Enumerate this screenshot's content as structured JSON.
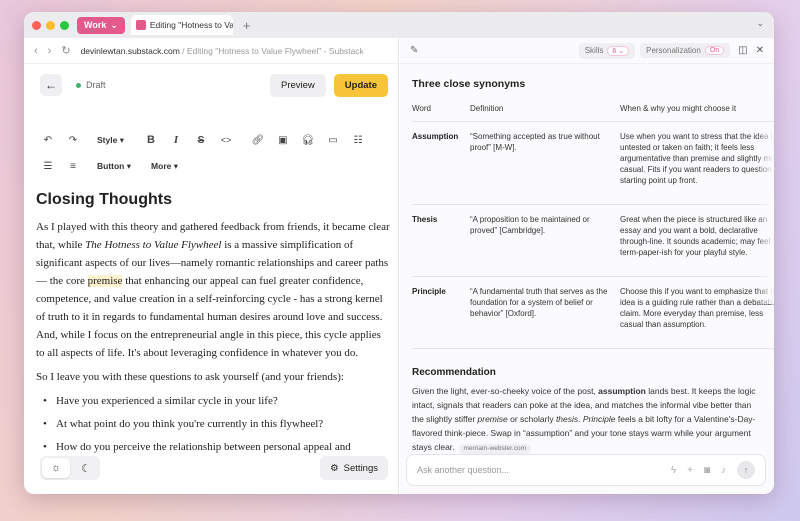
{
  "tabbar": {
    "workspace": "Work",
    "tab_title": "Editing \"Hotness to Va",
    "new_tab": "+",
    "menu_chevron": "⌄"
  },
  "urlbar": {
    "domain": "devinlewtan.substack.com",
    "rest": " / Editing \"Hotness to Value Flywheel\" - Substack"
  },
  "editor": {
    "status": "Draft",
    "preview_label": "Preview",
    "update_label": "Update",
    "style_label": "Style",
    "button_label": "Button",
    "more_label": "More",
    "settings_label": "Settings"
  },
  "article": {
    "heading": "Closing Thoughts",
    "p1_a": "As I played with this theory and gathered feedback from friends, it became clear that, while ",
    "p1_em": "The Hotness to Value Flywheel",
    "p1_b": " is a massive simplification of significant aspects of our lives—namely romantic relationships and career paths— the core ",
    "p1_hl": "premise",
    "p1_c": " that enhancing our appeal can fuel greater confidence, competence, and value creation in a self-reinforcing cycle - has a strong kernel of truth to it in regards to fundamental human desires around love and success. And, while I focus on the entrepreneurial angle in this piece, this cycle applies to all aspects of life. It's about leveraging confidence in whatever you do.",
    "p2": "So I leave you with these questions to ask yourself (and your friends):",
    "bullets": [
      "Have you experienced a similar cycle in your life?",
      "At what point do you think you're currently in this flywheel?",
      "How do you perceive the relationship between personal appeal and"
    ]
  },
  "assistant": {
    "skills_label": "Skills",
    "skills_count": "6",
    "personalization_label": "Personalization",
    "personalization_state": "On",
    "title": "Three close synonyms",
    "columns": [
      "Word",
      "Definition",
      "When & why you might choose it"
    ],
    "rows": [
      {
        "word": "Assumption",
        "definition": "“Something accepted as true without proof” [M-W].",
        "when": "Use when you want to stress that the idea is untested or taken on faith; it feels less argumentative than premise and slightly more casual. Fits if you want readers to question the starting point up front."
      },
      {
        "word": "Thesis",
        "definition": "“A proposition to be maintained or proved” [Cambridge].",
        "when": "Great when the piece is structured like an essay and you want a bold, declarative through-line. It sounds academic; may feel too term-paper-ish for your playful style."
      },
      {
        "word": "Principle",
        "definition": "“A fundamental truth that serves as the foundation for a system of belief or behavior” [Oxford].",
        "when": "Choose this if you want to emphasize that the idea is a guiding rule rather than a debatable claim. More everyday than premise, less casual than assumption."
      }
    ],
    "rec_title": "Recommendation",
    "rec_1": "Given the light, ever-so-cheeky voice of the post, ",
    "rec_b1": "assumption",
    "rec_2": " lands best. It keeps the logic intact, signals that readers can poke at the idea, and matches the informal vibe better than the slightly stiffer ",
    "rec_i1": "premise",
    "rec_3": " or scholarly ",
    "rec_i2": "thesis",
    "rec_4": ". ",
    "rec_i3": "Principle",
    "rec_5": " feels a bit lofty for a Valentine's-Day-flavored think-piece. Swap in “assumption” and your tone stays warm while your argument stays clear.",
    "source": "merriam-webster.com",
    "ask_placeholder": "Ask another question..."
  }
}
